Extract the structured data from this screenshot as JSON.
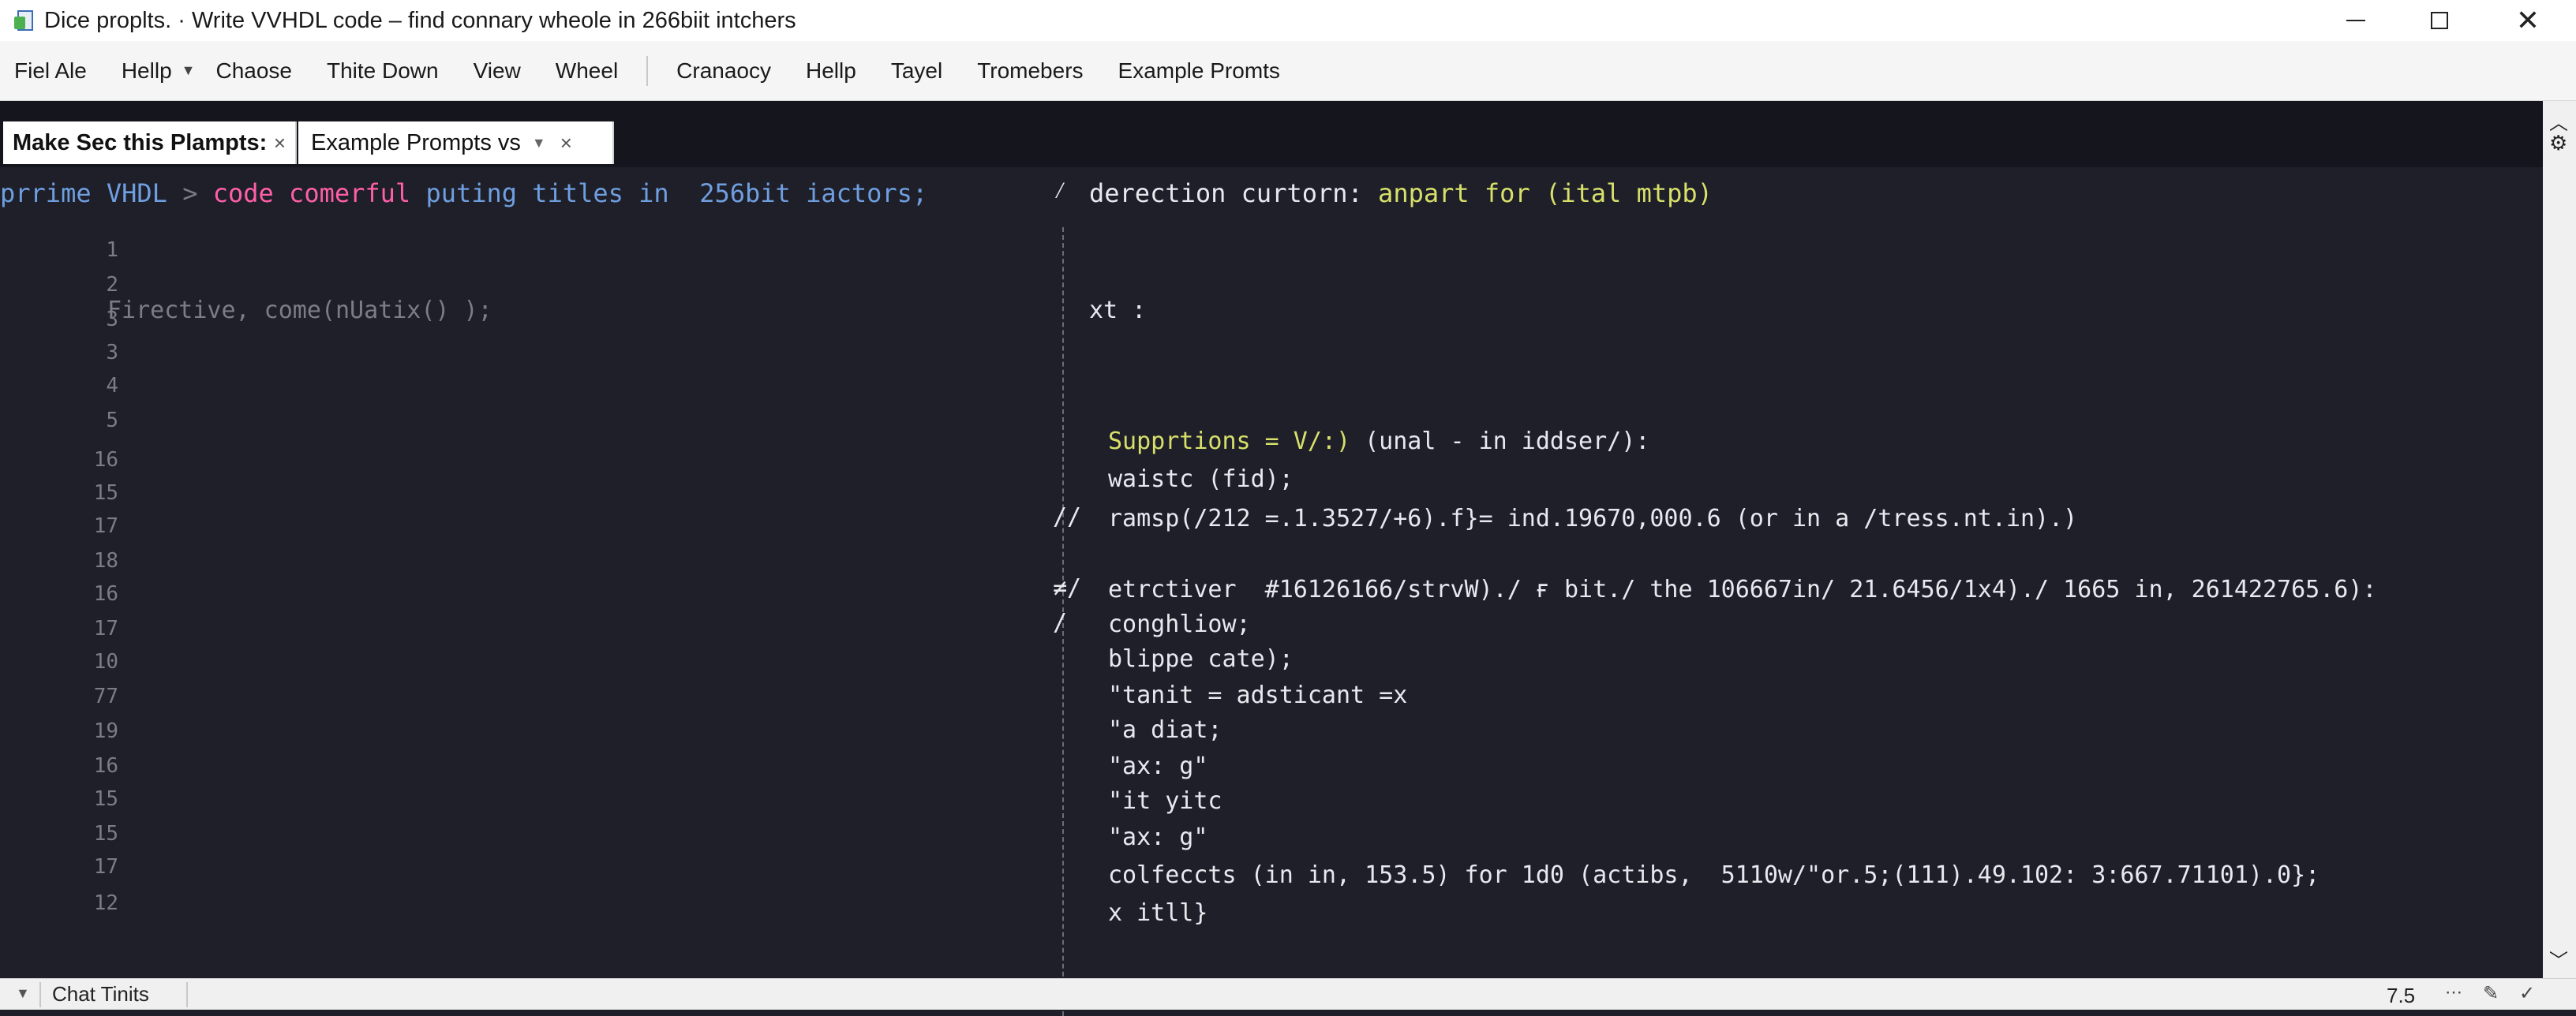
{
  "window": {
    "title": "Dice proplts. · Write VVHDL code – find connary wheole in 266biit intchers",
    "app_icon": "document-icon"
  },
  "menu": {
    "items": [
      "Fiel Ale",
      "Hellp",
      "Chaose",
      "Thite Down",
      "View",
      "Wheel",
      "Cranaocy",
      "Hellp",
      "Tayel",
      "Tromebers",
      "Example Promts"
    ]
  },
  "tabs": [
    {
      "label": "Make Sec this Plampts:",
      "close": "×"
    },
    {
      "label": "Example Prompts  vs",
      "close": "×"
    }
  ],
  "editor": {
    "header_left": {
      "part1": "prrime VHDL",
      "arrow": ">",
      "part2": "code comerful",
      "part3": "puting titles in  256bit iactors;"
    },
    "firective": "Firective, come(nUatix() );",
    "line_numbers": [
      "1",
      "2",
      "3",
      "3",
      "4",
      "5",
      "16",
      "15",
      "17",
      "18",
      "16",
      "17",
      "10",
      "77",
      "19",
      "16",
      "15",
      "15",
      "17",
      "12"
    ],
    "right_header": {
      "marker": "⁄",
      "white": "derection curtorn:",
      "yellow": "anpart for (ital mtpb)"
    },
    "right_xt": "xt :",
    "right_lines": [
      {
        "marker": "",
        "yellow": "Supprtions = V/:)",
        "white": " (unal - in iddser/):"
      },
      {
        "marker": "",
        "white": "waistc (fid);"
      },
      {
        "marker": "//",
        "white": "ramsp(/212 =.1.3527/+6).f}= ind.19670,000.6 (or in a /tress.nt.in).)"
      },
      {
        "marker": "≠/",
        "white": "etrctiver  #16126166/strvW)./ ғ bit./ the 106667in/ 21.6456/1x4)./ 1665 in, 261422765.6):"
      },
      {
        "marker": "/",
        "white": "conghliow;"
      },
      {
        "marker": "",
        "white": "blippe cate);"
      },
      {
        "marker": "",
        "white": "\"tanit = adsticant =x"
      },
      {
        "marker": "",
        "white": "\"a diat;"
      },
      {
        "marker": "",
        "white": "\"ax: g\""
      },
      {
        "marker": "",
        "white": "\"it yitc"
      },
      {
        "marker": "",
        "white": "\"ax: g\""
      },
      {
        "marker": "",
        "white": "colfeccts (in in, 153.5) for 1d0 (actibs,  5110w/\"or.5;(111).49.102: 3:667.71101).0};"
      },
      {
        "marker": "",
        "white": "x itll}"
      }
    ]
  },
  "statusbar": {
    "chat_label": "Chat Tinits",
    "zoom": "7.5",
    "icons": [
      "more-icon",
      "paint-icon",
      "check-icon"
    ]
  },
  "colors": {
    "editor_bg": "#1e1f29",
    "keyword_blue": "#6f9fe0",
    "keyword_pink": "#ff5fa8",
    "accent_yellow": "#d8e06a",
    "line_number_grey": "#7a7c86"
  }
}
